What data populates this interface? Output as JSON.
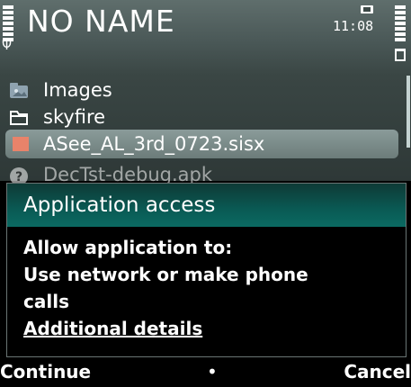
{
  "statusbar": {
    "title": "NO NAME",
    "time": "11:08",
    "icons": [
      "signal-strength-icon",
      "antenna-icon",
      "sim-icon",
      "battery-icon"
    ]
  },
  "file_list": {
    "items": [
      {
        "label": "Images",
        "icon": "image-folder-icon",
        "selected": false
      },
      {
        "label": "skyfire",
        "icon": "folder-icon",
        "selected": false
      },
      {
        "label": "ASee_AL_3rd_0723.sisx",
        "icon": "installer-file-icon",
        "selected": true
      },
      {
        "label": "DecTst-debug.apk",
        "icon": "unknown-file-icon",
        "selected": false
      }
    ]
  },
  "dialog": {
    "title": "Application access",
    "line1": "Allow application to:",
    "line2": "Use network or make phone",
    "line3": "calls",
    "link": "Additional details"
  },
  "softkeys": {
    "left": "Continue",
    "middle": "•",
    "right": "Cancel"
  },
  "colors": {
    "header_gradient_top": "#0e3a36",
    "header_gradient_bottom": "#0b6a62",
    "selection": "#7e8f8d",
    "installer_icon": "#e8836a"
  }
}
